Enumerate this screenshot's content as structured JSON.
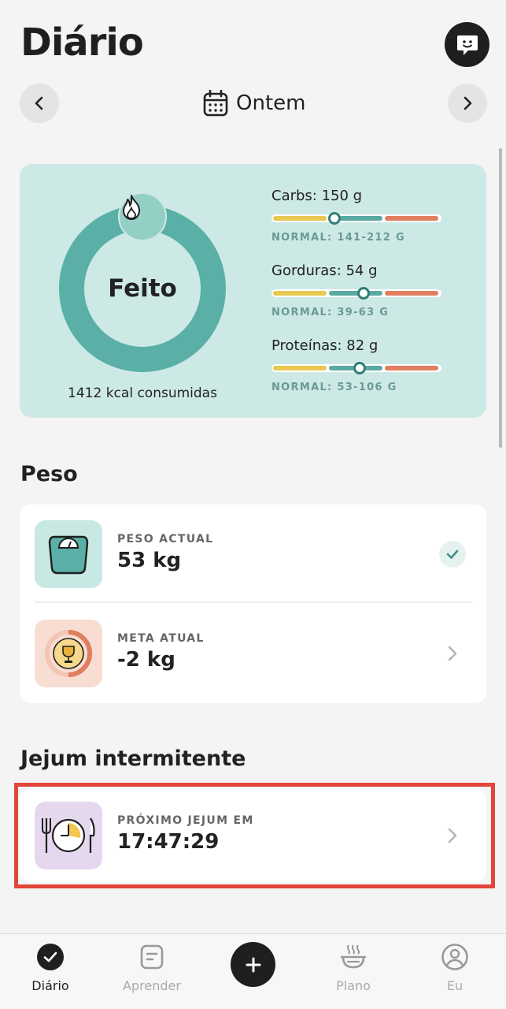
{
  "header": {
    "title": "Diário",
    "date_label": "Ontem"
  },
  "summary": {
    "status": "Feito",
    "kcal_text": "1412 kcal consumidas",
    "macros": [
      {
        "title": "Carbs: 150 g",
        "range": "NORMAL: 141-212 G",
        "position": 0.37
      },
      {
        "title": "Gorduras: 54 g",
        "range": "NORMAL: 39-63 G",
        "position": 0.54
      },
      {
        "title": "Proteínas: 82 g",
        "range": "NORMAL: 53-106 G",
        "position": 0.52
      }
    ]
  },
  "weight": {
    "section_title": "Peso",
    "current_label": "PESO ACTUAL",
    "current_value": "53 kg",
    "goal_label": "META ATUAL",
    "goal_value": "-2 kg"
  },
  "fasting": {
    "section_title": "Jejum intermitente",
    "label": "PRÓXIMO JEJUM EM",
    "countdown": "17:47:29"
  },
  "bottom_nav": {
    "items": [
      {
        "label": "Diário",
        "icon": "check-circle-icon",
        "active": true
      },
      {
        "label": "Aprender",
        "icon": "notes-icon",
        "active": false
      },
      {
        "label": "Plano",
        "icon": "bowl-icon",
        "active": false
      },
      {
        "label": "Eu",
        "icon": "user-icon",
        "active": false
      }
    ],
    "add_icon": "plus-icon"
  },
  "colors": {
    "accent_teal": "#5ab0a6",
    "card_bg": "#cde9e6",
    "highlight_red": "#e2453a",
    "bar_yellow": "#e8c850",
    "bar_green": "#5aa9a3",
    "bar_red": "#df7f5f"
  }
}
